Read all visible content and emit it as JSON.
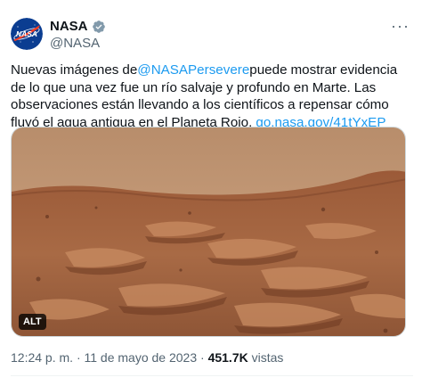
{
  "tweet": {
    "author": {
      "display_name": "NASA",
      "handle": "@NASA",
      "avatar_text": "NASA",
      "verified": true
    },
    "more_icon": "ellipsis-icon",
    "text_before": "Nuevas imágenes de",
    "mention": "@NASAPersevere",
    "text_after": "puede mostrar evidencia de lo que una vez fue un río salvaje y profundo en Marte. Las observaciones están llevando a los científicos a repensar cómo fluyó el agua antigua en el Planeta Rojo.",
    "link": "go.nasa.gov/41tYxEP",
    "media": {
      "alt_label": "ALT"
    },
    "meta": {
      "time": "12:24 p. m.",
      "separator": "·",
      "date": "11 de mayo de 2023",
      "views_count": "451.7K",
      "views_label": "vistas"
    }
  },
  "colors": {
    "link": "#1d9bf0",
    "secondary_text": "#536471",
    "nasa_blue": "#0b3d91",
    "nasa_red": "#fc3d21",
    "mars_sky": "#c69a72",
    "mars_ground": "#a8643e"
  }
}
